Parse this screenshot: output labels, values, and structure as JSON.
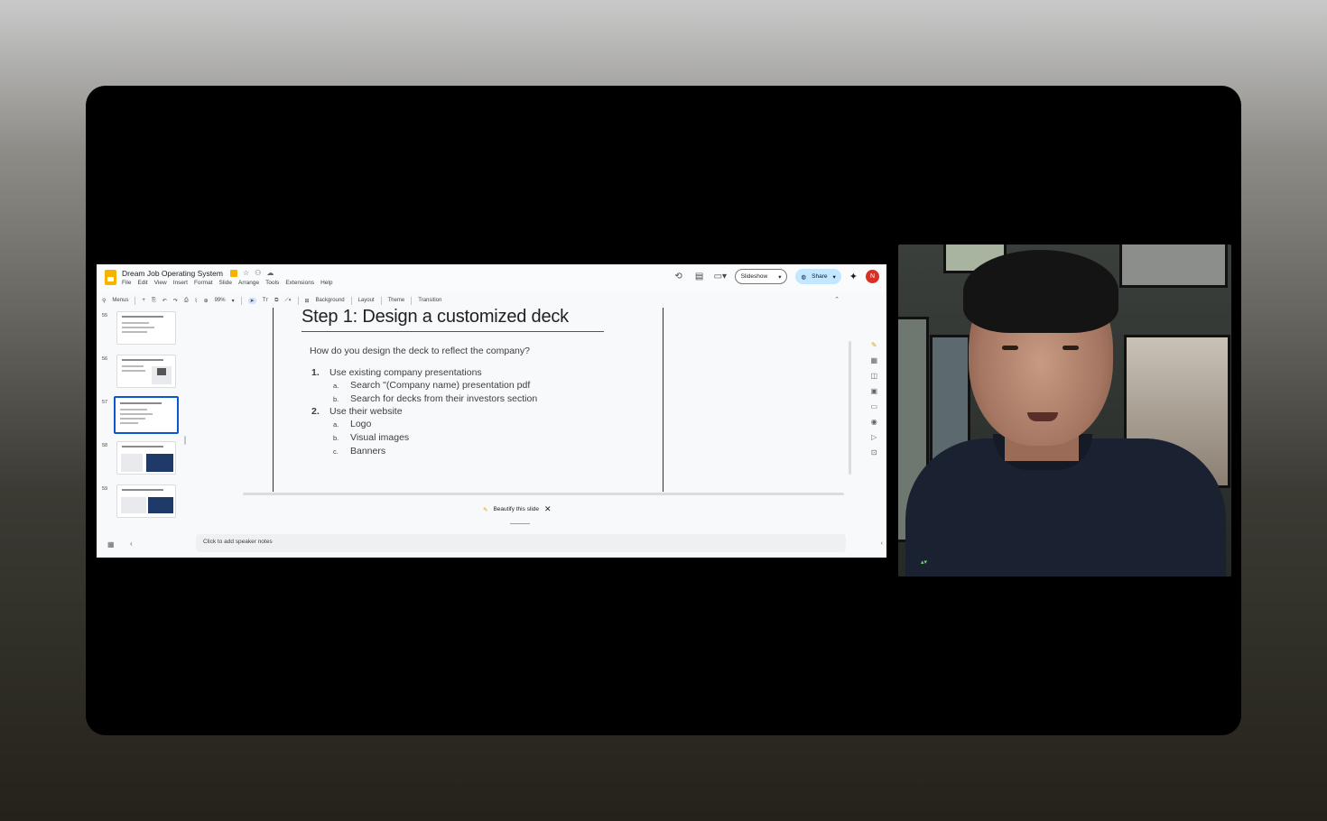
{
  "app": {
    "doc_title": "Dream Job Operating System",
    "menus": [
      "File",
      "Edit",
      "View",
      "Insert",
      "Format",
      "Slide",
      "Arrange",
      "Tools",
      "Extensions",
      "Help"
    ],
    "slideshow_label": "Slideshow",
    "share_label": "Share",
    "avatar_letter": "N"
  },
  "toolbar": {
    "search_label": "Menus",
    "zoom": "99%",
    "text_tool": "Tт",
    "buttons": [
      "Background",
      "Layout",
      "Theme",
      "Transition"
    ]
  },
  "filmstrip": {
    "numbers": [
      "55",
      "56",
      "57",
      "58",
      "59"
    ],
    "active_index": 2
  },
  "slide": {
    "title": "Step 1: Design a customized deck",
    "question": "How do you design the deck to reflect the company?",
    "items": [
      {
        "num": "1.",
        "text": "Use existing company presentations",
        "subs": [
          {
            "letter": "a.",
            "text": "Search \"(Company name) presentation pdf"
          },
          {
            "letter": "b.",
            "text": "Search for decks from their investors section"
          }
        ]
      },
      {
        "num": "2.",
        "text": "Use their website",
        "subs": [
          {
            "letter": "a.",
            "text": "Logo"
          },
          {
            "letter": "b.",
            "text": "Visual images"
          },
          {
            "letter": "c.",
            "text": "Banners"
          }
        ]
      }
    ]
  },
  "beautify_label": "Beautify this slide",
  "notes_placeholder": "Click to add speaker notes",
  "colors": {
    "accent": "#0b57d0",
    "share_bg": "#c2e7ff",
    "avatar_bg": "#d93025",
    "slides_yellow": "#f4b400"
  }
}
